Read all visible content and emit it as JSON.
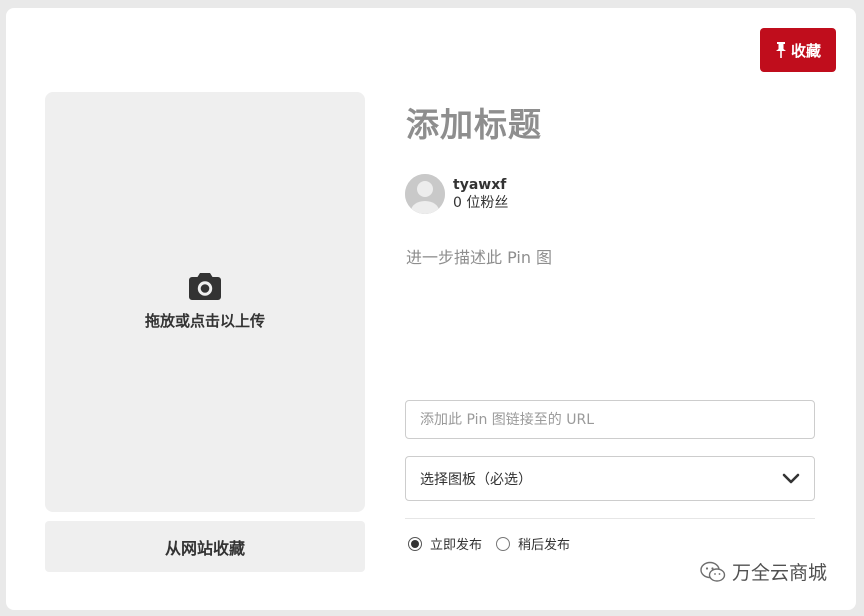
{
  "header": {
    "save_label": "收藏",
    "save_icon": "pin-icon",
    "accent_color": "#c00d1c"
  },
  "upload": {
    "icon": "camera-icon",
    "label": "拖放或点击以上传",
    "from_site_label": "从网站收藏"
  },
  "pin": {
    "title_placeholder": "添加标题",
    "description_placeholder": "进一步描述此 Pin 图",
    "url_placeholder": "添加此 Pin 图链接至的 URL",
    "url_value": ""
  },
  "user": {
    "name": "tyawxf",
    "followers": "0 位粉丝",
    "avatar_icon": "default-user-icon"
  },
  "board": {
    "selected": "选择图板（必选）",
    "icon": "chevron-down-icon"
  },
  "publish": {
    "options": [
      {
        "label": "立即发布",
        "checked": true
      },
      {
        "label": "稍后发布",
        "checked": false
      }
    ]
  },
  "watermark": {
    "text": "万全云商城",
    "icon": "wechat-icon"
  }
}
